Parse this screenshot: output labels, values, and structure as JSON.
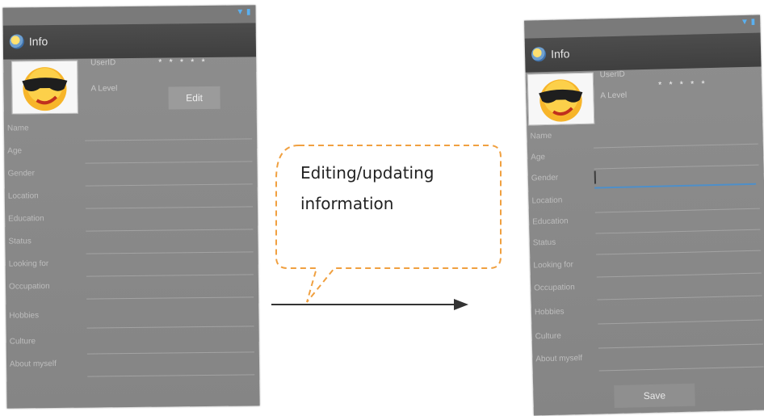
{
  "left_screen": {
    "app_title": "Info",
    "user_id_label": "UserID",
    "user_id_value": "* * * * *",
    "level_label": "A Level",
    "edit_button": "Edit",
    "fields": [
      "Name",
      "Age",
      "Gender",
      "Location",
      "Education",
      "Status",
      "Looking for",
      "Occupation",
      "Hobbies",
      "Culture",
      "About myself"
    ]
  },
  "right_screen": {
    "app_title": "Info",
    "user_id_label": "UserID",
    "user_id_value": "* * * * *",
    "level_label": "A Level",
    "save_button": "Save",
    "focused_field": "Gender",
    "fields": [
      "Name",
      "Age",
      "Gender",
      "Location",
      "Education",
      "Status",
      "Looking for",
      "Occupation",
      "Hobbies",
      "Culture",
      "About myself"
    ]
  },
  "callout": {
    "line1": "Editing/updating",
    "line2": "information"
  },
  "colors": {
    "callout_border": "#f0a040",
    "focus_line": "#4e8fc9",
    "action_bar": "#444444"
  }
}
